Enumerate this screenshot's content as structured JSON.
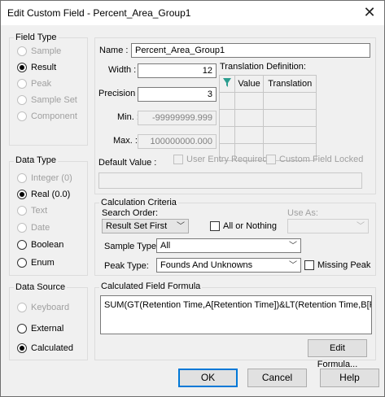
{
  "window": {
    "title": "Edit Custom Field - Percent_Area_Group1",
    "close_glyph": "✕"
  },
  "field_type": {
    "label": "Field Type",
    "options": [
      {
        "label": "Sample",
        "enabled": false,
        "selected": false
      },
      {
        "label": "Result",
        "enabled": true,
        "selected": true
      },
      {
        "label": "Peak",
        "enabled": false,
        "selected": false
      },
      {
        "label": "Sample Set",
        "enabled": false,
        "selected": false
      },
      {
        "label": "Component",
        "enabled": false,
        "selected": false
      }
    ]
  },
  "data_type": {
    "label": "Data Type",
    "options": [
      {
        "label": "Integer (0)",
        "enabled": false,
        "selected": false
      },
      {
        "label": "Real (0.0)",
        "enabled": true,
        "selected": true
      },
      {
        "label": "Text",
        "enabled": false,
        "selected": false
      },
      {
        "label": "Date",
        "enabled": false,
        "selected": false
      },
      {
        "label": "Boolean",
        "enabled": true,
        "selected": false
      },
      {
        "label": "Enum",
        "enabled": true,
        "selected": false
      }
    ]
  },
  "data_source": {
    "label": "Data Source",
    "options": [
      {
        "label": "Keyboard",
        "enabled": false,
        "selected": false
      },
      {
        "label": "External",
        "enabled": true,
        "selected": false
      },
      {
        "label": "Calculated",
        "enabled": true,
        "selected": true
      }
    ]
  },
  "fields": {
    "name_label": "Name :",
    "name_value": "Percent_Area_Group1",
    "width_label": "Width :",
    "width_value": "12",
    "precision_label": "Precision :",
    "precision_value": "3",
    "min_label": "Min. :",
    "min_value": "-99999999.999",
    "max_label": "Max. :",
    "max_value": "100000000.000",
    "default_label": "Default Value :",
    "default_value": ""
  },
  "translation": {
    "label": "Translation Definition:",
    "columns": [
      "Value",
      "Translation"
    ],
    "header_icon": "sort-filter-icon"
  },
  "options": {
    "user_entry_required": "User Entry Required",
    "custom_field_locked": "Custom Field Locked"
  },
  "calc": {
    "group_label": "Calculation Criteria",
    "search_order_label": "Search Order:",
    "search_order_value": "Result Set First",
    "all_or_nothing": "All or Nothing",
    "use_as_label": "Use As:",
    "use_as_value": "",
    "sample_type_label": "Sample Type:",
    "sample_type_value": "All",
    "peak_type_label": "Peak Type:",
    "peak_type_value": "Founds And Unknowns",
    "missing_peak": "Missing Peak"
  },
  "formula": {
    "group_label": "Calculated Field Formula",
    "text": "SUM(GT(Retention Time,A[Retention Time])&LT(Retention Time,B[Retention",
    "edit_button": "Edit Formula..."
  },
  "buttons": {
    "ok": "OK",
    "cancel": "Cancel",
    "help": "Help"
  },
  "colors": {
    "accent": "#0078d7",
    "teal_icon": "#2a9d8f"
  }
}
